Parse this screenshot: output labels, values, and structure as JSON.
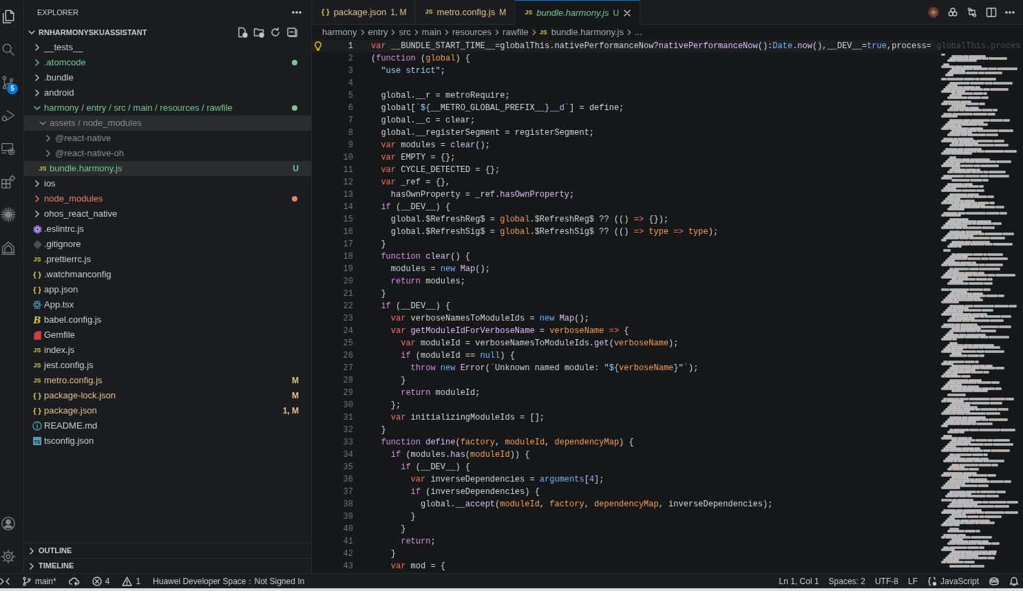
{
  "activity_bar": {
    "items": [
      {
        "kind": "files",
        "selected": true
      },
      {
        "kind": "search",
        "selected": false
      },
      {
        "kind": "source-control",
        "selected": false,
        "badge": "5"
      },
      {
        "kind": "run",
        "selected": false
      },
      {
        "kind": "remote",
        "selected": false
      },
      {
        "kind": "extensions",
        "selected": false
      },
      {
        "kind": "starburst",
        "selected": false
      },
      {
        "kind": "harmony",
        "selected": false
      }
    ],
    "bottom": [
      {
        "kind": "account"
      },
      {
        "kind": "settings"
      }
    ]
  },
  "sidebar": {
    "title": "EXPLORER",
    "tree": {
      "label": "RNHARMONYSKUASSISTANT",
      "expanded": true,
      "children": [
        {
          "kind": "folder",
          "label": "__tests__",
          "expanded": false,
          "selected": false
        },
        {
          "kind": "folder",
          "label": ".atomcode",
          "expanded": false,
          "selected": false,
          "color": "#73c991",
          "dot": true
        },
        {
          "kind": "folder",
          "label": ".bundle",
          "expanded": false,
          "selected": false
        },
        {
          "kind": "folder",
          "label": "android",
          "expanded": false,
          "selected": false
        },
        {
          "kind": "folder",
          "label": "harmony / entry / src / main / resources / rawfile",
          "expanded": true,
          "selected": false,
          "color": "#73c991",
          "dot": true,
          "children": [
            {
              "kind": "folder",
              "label": "assets / node_modules",
              "expanded": true,
              "selected": true,
              "color": "#8c8c8c",
              "children": [
                {
                  "kind": "folder",
                  "label": "@react-native",
                  "expanded": false,
                  "selected": false,
                  "color": "#8c8c8c"
                },
                {
                  "kind": "folder",
                  "label": "@react-native-oh",
                  "expanded": false,
                  "selected": false,
                  "color": "#8c8c8c"
                }
              ]
            },
            {
              "kind": "js",
              "glyph": "JS",
              "label": "bundle.harmony.js",
              "selected": true,
              "color": "#73c991",
              "badge": "U"
            }
          ]
        },
        {
          "kind": "folder",
          "label": "ios",
          "expanded": false,
          "selected": false
        },
        {
          "kind": "folder",
          "label": "node_modules",
          "expanded": false,
          "selected": false,
          "color": "#e8806c",
          "dot": true
        },
        {
          "kind": "folder",
          "label": "ohos_react_native",
          "expanded": false,
          "selected": false
        },
        {
          "kind": "eslint",
          "label": ".eslintrc.js",
          "selected": false
        },
        {
          "kind": "git",
          "label": ".gitignore",
          "selected": false
        },
        {
          "kind": "js",
          "glyph": "JS",
          "label": ".prettierrc.js",
          "selected": false
        },
        {
          "kind": "json",
          "glyph": "{ }",
          "label": ".watchmanconfig",
          "selected": false
        },
        {
          "kind": "json",
          "glyph": "{ }",
          "label": "app.json",
          "selected": false
        },
        {
          "kind": "react",
          "label": "App.tsx",
          "selected": false
        },
        {
          "kind": "babel",
          "glyph": "B",
          "label": "babel.config.js",
          "selected": false
        },
        {
          "kind": "ruby",
          "label": "Gemfile",
          "selected": false
        },
        {
          "kind": "js",
          "glyph": "JS",
          "label": "index.js",
          "selected": false
        },
        {
          "kind": "js",
          "glyph": "JS",
          "label": "jest.config.js",
          "selected": false
        },
        {
          "kind": "js",
          "glyph": "JS",
          "label": "metro.config.js",
          "selected": false,
          "color": "#e2c08d",
          "badge": "M"
        },
        {
          "kind": "json",
          "glyph": "{ }",
          "label": "package-lock.json",
          "selected": false,
          "color": "#e2c08d",
          "badge": "M"
        },
        {
          "kind": "json",
          "glyph": "{ }",
          "label": "package.json",
          "selected": false,
          "color": "#e2c08d",
          "badge": "1, M"
        },
        {
          "kind": "info",
          "label": "README.md",
          "selected": false
        },
        {
          "kind": "ts",
          "glyph": "TS",
          "label": "tsconfig.json",
          "selected": false
        }
      ]
    },
    "sections": [
      {
        "label": "OUTLINE",
        "expanded": false
      },
      {
        "label": "TIMELINE",
        "expanded": false
      }
    ]
  },
  "tabs": [
    {
      "kind": "json",
      "glyph": "{ }",
      "label": "package.json",
      "badge": "1, M",
      "color": "#e2c08d",
      "selected": false,
      "preview": false
    },
    {
      "kind": "js",
      "glyph": "JS",
      "label": "metro.config.js",
      "badge": "M",
      "color": "#e2c08d",
      "selected": false,
      "preview": false
    },
    {
      "kind": "js",
      "glyph": "JS",
      "label": "bundle.harmony.js",
      "badge": "U",
      "color": "#73c991",
      "selected": true,
      "preview": true
    }
  ],
  "breadcrumbs": [
    {
      "kind": "folder",
      "label": "harmony"
    },
    {
      "kind": "folder",
      "label": "entry"
    },
    {
      "kind": "folder",
      "label": "src"
    },
    {
      "kind": "folder",
      "label": "main"
    },
    {
      "kind": "folder",
      "label": "resources"
    },
    {
      "kind": "folder",
      "label": "rawfile"
    },
    {
      "kind": "js",
      "glyph": "JS",
      "label": "bundle.harmony.js"
    },
    {
      "kind": "more",
      "label": "..."
    }
  ],
  "editor": {
    "suggestion": "globalThis.proces",
    "lines": [
      {
        "n": "1",
        "current": true,
        "tokens": [
          {
            "kind": "keyword",
            "text": "var"
          },
          {
            "kind": "text",
            "text": " __BUNDLE_START_TIME__=globalThis.nativePerformanceNow?"
          },
          {
            "kind": "function",
            "text": "nativePerformanceNow"
          },
          {
            "kind": "text",
            "text": "():"
          },
          {
            "kind": "constant",
            "text": "Date"
          },
          {
            "kind": "text",
            "text": "."
          },
          {
            "kind": "function",
            "text": "now"
          },
          {
            "kind": "text",
            "text": "(),__DEV__="
          },
          {
            "kind": "constant",
            "text": "true"
          },
          {
            "kind": "text",
            "text": ",process="
          }
        ]
      },
      {
        "n": "2",
        "current": false,
        "tokens": [
          {
            "kind": "text",
            "text": "("
          },
          {
            "kind": "control",
            "text": "function"
          },
          {
            "kind": "text",
            "text": " ("
          },
          {
            "kind": "param",
            "text": "global"
          },
          {
            "kind": "text",
            "text": ") {"
          }
        ]
      },
      {
        "n": "3",
        "current": false,
        "tokens": [
          {
            "kind": "string",
            "text": "  \"use strict\""
          },
          {
            "kind": "text",
            "text": ";"
          }
        ]
      },
      {
        "n": "4",
        "current": false
      },
      {
        "n": "5",
        "current": false,
        "tokens": [
          {
            "kind": "text",
            "text": "  global.__r = metroRequire;"
          }
        ]
      },
      {
        "n": "6",
        "current": false,
        "tokens": [
          {
            "kind": "text",
            "text": "  global["
          },
          {
            "kind": "string",
            "text": "`${"
          },
          {
            "kind": "text",
            "text": "__METRO_GLOBAL_PREFIX__"
          },
          {
            "kind": "string",
            "text": "}__d`"
          },
          {
            "kind": "text",
            "text": "] = define;"
          }
        ]
      },
      {
        "n": "7",
        "current": false,
        "tokens": [
          {
            "kind": "text",
            "text": "  global.__c = clear;"
          }
        ]
      },
      {
        "n": "8",
        "current": false,
        "tokens": [
          {
            "kind": "text",
            "text": "  global.__registerSegment = registerSegment;"
          }
        ]
      },
      {
        "n": "9",
        "current": false,
        "tokens": [
          {
            "kind": "keyword",
            "text": "  var"
          },
          {
            "kind": "text",
            "text": " modules = "
          },
          {
            "kind": "function",
            "text": "clear"
          },
          {
            "kind": "text",
            "text": "();"
          }
        ]
      },
      {
        "n": "10",
        "current": false,
        "tokens": [
          {
            "kind": "keyword",
            "text": "  var"
          },
          {
            "kind": "text",
            "text": " EMPTY = {};"
          }
        ]
      },
      {
        "n": "11",
        "current": false,
        "tokens": [
          {
            "kind": "keyword",
            "text": "  var"
          },
          {
            "kind": "text",
            "text": " CYCLE_DETECTED = {};"
          }
        ]
      },
      {
        "n": "12",
        "current": false,
        "tokens": [
          {
            "kind": "keyword",
            "text": "  var"
          },
          {
            "kind": "text",
            "text": " _ref = {},"
          }
        ]
      },
      {
        "n": "13",
        "current": false,
        "tokens": [
          {
            "kind": "text",
            "text": "    hasOwnProperty = _ref."
          },
          {
            "kind": "function",
            "text": "hasOwnProperty"
          },
          {
            "kind": "text",
            "text": ";"
          }
        ]
      },
      {
        "n": "14",
        "current": false,
        "tokens": [
          {
            "kind": "control",
            "text": "  if"
          },
          {
            "kind": "text",
            "text": " (__DEV__) {"
          }
        ]
      },
      {
        "n": "15",
        "current": false,
        "tokens": [
          {
            "kind": "text",
            "text": "    global.$RefreshReg$ = "
          },
          {
            "kind": "param",
            "text": "global"
          },
          {
            "kind": "text",
            "text": ".$RefreshReg$ ?? (() "
          },
          {
            "kind": "keyword",
            "text": "=>"
          },
          {
            "kind": "text",
            "text": " {});"
          }
        ]
      },
      {
        "n": "16",
        "current": false,
        "tokens": [
          {
            "kind": "text",
            "text": "    global.$RefreshSig$ = "
          },
          {
            "kind": "param",
            "text": "global"
          },
          {
            "kind": "text",
            "text": ".$RefreshSig$ ?? (() "
          },
          {
            "kind": "keyword",
            "text": "=>"
          },
          {
            "kind": "param",
            "text": " type"
          },
          {
            "kind": "keyword",
            "text": " =>"
          },
          {
            "kind": "param",
            "text": " type"
          },
          {
            "kind": "text",
            "text": ");"
          }
        ]
      },
      {
        "n": "17",
        "current": false,
        "tokens": [
          {
            "kind": "text",
            "text": "  }"
          }
        ]
      },
      {
        "n": "18",
        "current": false,
        "tokens": [
          {
            "kind": "control",
            "text": "  function"
          },
          {
            "kind": "function",
            "text": " clear"
          },
          {
            "kind": "text",
            "text": "() {"
          }
        ]
      },
      {
        "n": "19",
        "current": false,
        "tokens": [
          {
            "kind": "text",
            "text": "    modules = "
          },
          {
            "kind": "constant",
            "text": "new"
          },
          {
            "kind": "function",
            "text": " Map"
          },
          {
            "kind": "text",
            "text": "();"
          }
        ]
      },
      {
        "n": "20",
        "current": false,
        "tokens": [
          {
            "kind": "control",
            "text": "    return"
          },
          {
            "kind": "text",
            "text": " modules;"
          }
        ]
      },
      {
        "n": "21",
        "current": false,
        "tokens": [
          {
            "kind": "text",
            "text": "  }"
          }
        ]
      },
      {
        "n": "22",
        "current": false,
        "tokens": [
          {
            "kind": "control",
            "text": "  if"
          },
          {
            "kind": "text",
            "text": " (__DEV__) {"
          }
        ]
      },
      {
        "n": "23",
        "current": false,
        "tokens": [
          {
            "kind": "keyword",
            "text": "    var"
          },
          {
            "kind": "text",
            "text": " verboseNamesToModuleIds = "
          },
          {
            "kind": "constant",
            "text": "new"
          },
          {
            "kind": "function",
            "text": " Map"
          },
          {
            "kind": "text",
            "text": "();"
          }
        ]
      },
      {
        "n": "24",
        "current": false,
        "tokens": [
          {
            "kind": "keyword",
            "text": "    var"
          },
          {
            "kind": "function",
            "text": " getModuleIdForVerboseName"
          },
          {
            "kind": "text",
            "text": " = "
          },
          {
            "kind": "param",
            "text": "verboseName"
          },
          {
            "kind": "keyword",
            "text": " =>"
          },
          {
            "kind": "text",
            "text": " {"
          }
        ]
      },
      {
        "n": "25",
        "current": false,
        "tokens": [
          {
            "kind": "keyword",
            "text": "      var"
          },
          {
            "kind": "text",
            "text": " moduleId = verboseNamesToModuleIds."
          },
          {
            "kind": "function",
            "text": "get"
          },
          {
            "kind": "text",
            "text": "("
          },
          {
            "kind": "param",
            "text": "verboseName"
          },
          {
            "kind": "text",
            "text": ");"
          }
        ]
      },
      {
        "n": "26",
        "current": false,
        "tokens": [
          {
            "kind": "control",
            "text": "      if"
          },
          {
            "kind": "text",
            "text": " (moduleId == "
          },
          {
            "kind": "constant",
            "text": "null"
          },
          {
            "kind": "text",
            "text": ") {"
          }
        ]
      },
      {
        "n": "27",
        "current": false,
        "tokens": [
          {
            "kind": "control",
            "text": "        throw"
          },
          {
            "kind": "constant",
            "text": " new"
          },
          {
            "kind": "function",
            "text": " Error"
          },
          {
            "kind": "text",
            "text": "("
          },
          {
            "kind": "string",
            "text": "`"
          },
          {
            "kind": "text",
            "text": "Unknown named module: "
          },
          {
            "kind": "string",
            "text": "\"${"
          },
          {
            "kind": "param",
            "text": "verboseName"
          },
          {
            "kind": "string",
            "text": "}\"`"
          },
          {
            "kind": "text",
            "text": ");"
          }
        ]
      },
      {
        "n": "28",
        "current": false,
        "tokens": [
          {
            "kind": "text",
            "text": "      }"
          }
        ]
      },
      {
        "n": "29",
        "current": false,
        "tokens": [
          {
            "kind": "control",
            "text": "      return"
          },
          {
            "kind": "text",
            "text": " moduleId;"
          }
        ]
      },
      {
        "n": "30",
        "current": false,
        "tokens": [
          {
            "kind": "text",
            "text": "    };"
          }
        ]
      },
      {
        "n": "31",
        "current": false,
        "tokens": [
          {
            "kind": "keyword",
            "text": "    var"
          },
          {
            "kind": "text",
            "text": " initializingModuleIds = [];"
          }
        ]
      },
      {
        "n": "32",
        "current": false,
        "tokens": [
          {
            "kind": "text",
            "text": "  }"
          }
        ]
      },
      {
        "n": "33",
        "current": false,
        "tokens": [
          {
            "kind": "control",
            "text": "  function"
          },
          {
            "kind": "function",
            "text": " define"
          },
          {
            "kind": "text",
            "text": "("
          },
          {
            "kind": "param",
            "text": "factory"
          },
          {
            "kind": "text",
            "text": ", "
          },
          {
            "kind": "param",
            "text": "moduleId"
          },
          {
            "kind": "text",
            "text": ", "
          },
          {
            "kind": "param",
            "text": "dependencyMap"
          },
          {
            "kind": "text",
            "text": ") {"
          }
        ]
      },
      {
        "n": "34",
        "current": false,
        "tokens": [
          {
            "kind": "control",
            "text": "    if"
          },
          {
            "kind": "text",
            "text": " (modules."
          },
          {
            "kind": "function",
            "text": "has"
          },
          {
            "kind": "text",
            "text": "("
          },
          {
            "kind": "param",
            "text": "moduleId"
          },
          {
            "kind": "text",
            "text": ")) {"
          }
        ]
      },
      {
        "n": "35",
        "current": false,
        "tokens": [
          {
            "kind": "control",
            "text": "      if"
          },
          {
            "kind": "text",
            "text": " (__DEV__) {"
          }
        ]
      },
      {
        "n": "36",
        "current": false,
        "tokens": [
          {
            "kind": "keyword",
            "text": "        var"
          },
          {
            "kind": "text",
            "text": " inverseDependencies = "
          },
          {
            "kind": "constant",
            "text": "arguments"
          },
          {
            "kind": "text",
            "text": "["
          },
          {
            "kind": "constant",
            "text": "4"
          },
          {
            "kind": "text",
            "text": "];"
          }
        ]
      },
      {
        "n": "37",
        "current": false,
        "tokens": [
          {
            "kind": "control",
            "text": "        if"
          },
          {
            "kind": "text",
            "text": " (inverseDependencies) {"
          }
        ]
      },
      {
        "n": "38",
        "current": false,
        "tokens": [
          {
            "kind": "text",
            "text": "          global."
          },
          {
            "kind": "function",
            "text": "__accept"
          },
          {
            "kind": "text",
            "text": "("
          },
          {
            "kind": "param",
            "text": "moduleId"
          },
          {
            "kind": "text",
            "text": ", "
          },
          {
            "kind": "param",
            "text": "factory"
          },
          {
            "kind": "text",
            "text": ", "
          },
          {
            "kind": "param",
            "text": "dependencyMap"
          },
          {
            "kind": "text",
            "text": ", inverseDependencies);"
          }
        ]
      },
      {
        "n": "39",
        "current": false,
        "tokens": [
          {
            "kind": "text",
            "text": "        }"
          }
        ]
      },
      {
        "n": "40",
        "current": false,
        "tokens": [
          {
            "kind": "text",
            "text": "      }"
          }
        ]
      },
      {
        "n": "41",
        "current": false,
        "tokens": [
          {
            "kind": "control",
            "text": "      return"
          },
          {
            "kind": "text",
            "text": ";"
          }
        ]
      },
      {
        "n": "42",
        "current": false,
        "tokens": [
          {
            "kind": "text",
            "text": "    }"
          }
        ]
      },
      {
        "n": "43",
        "current": false,
        "tokens": [
          {
            "kind": "keyword",
            "text": "    var"
          },
          {
            "kind": "text",
            "text": " mod = {"
          }
        ]
      }
    ]
  },
  "status_bar": {
    "left": [
      {
        "kind": "remote"
      },
      {
        "kind": "branch",
        "text": "main*"
      },
      {
        "kind": "sync"
      },
      {
        "kind": "errors",
        "text": "4"
      },
      {
        "kind": "warnings",
        "text": "1"
      },
      {
        "kind": "plain",
        "text": "Huawei Developer Space：Not Signed In"
      }
    ],
    "right": [
      {
        "kind": "plain",
        "text": "Ln 1, Col 1"
      },
      {
        "kind": "plain",
        "text": "Spaces: 2"
      },
      {
        "kind": "plain",
        "text": "UTF-8"
      },
      {
        "kind": "plain",
        "text": "LF"
      },
      {
        "kind": "language",
        "text": "JavaScript"
      },
      {
        "kind": "copilot"
      },
      {
        "kind": "bell"
      }
    ]
  }
}
